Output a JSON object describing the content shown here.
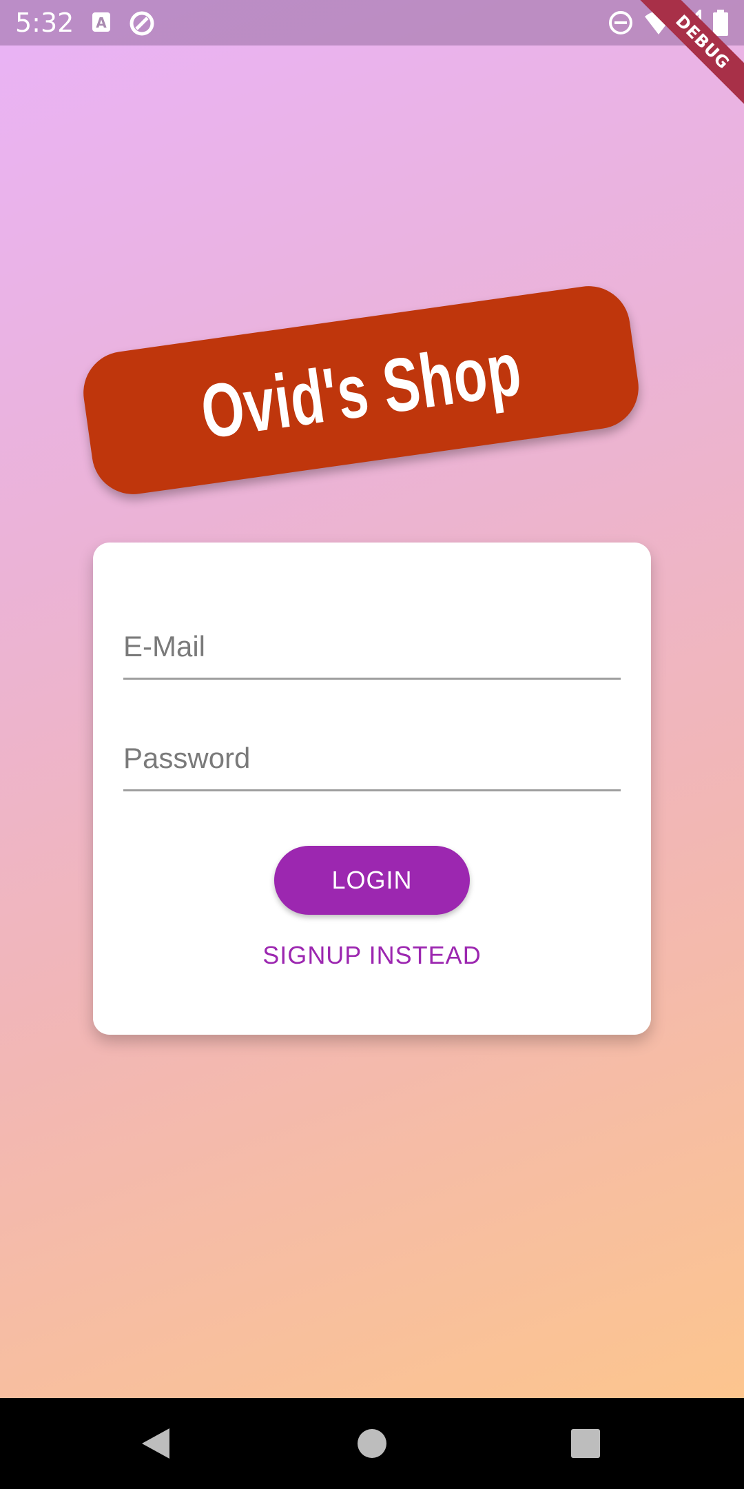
{
  "status_bar": {
    "time": "5:32",
    "left_icons": [
      "a-notification-icon",
      "sync-icon"
    ],
    "right_icons": [
      "do-not-disturb-icon",
      "wifi-icon",
      "signal-icon",
      "battery-icon"
    ]
  },
  "debug_banner": {
    "label": "DEBUG",
    "color": "#a83048"
  },
  "app": {
    "title": "Ovid's Shop",
    "title_color": "#bf360c",
    "background_gradient": [
      "#e9b3f7",
      "#fcc58e"
    ]
  },
  "login_form": {
    "email": {
      "placeholder": "E-Mail",
      "value": ""
    },
    "password": {
      "placeholder": "Password",
      "value": ""
    },
    "login_label": "LOGIN",
    "signup_label": "SIGNUP INSTEAD",
    "accent_color": "#9c27b0"
  },
  "nav_bar": {
    "buttons": [
      "back-icon",
      "home-icon",
      "recents-icon"
    ]
  }
}
